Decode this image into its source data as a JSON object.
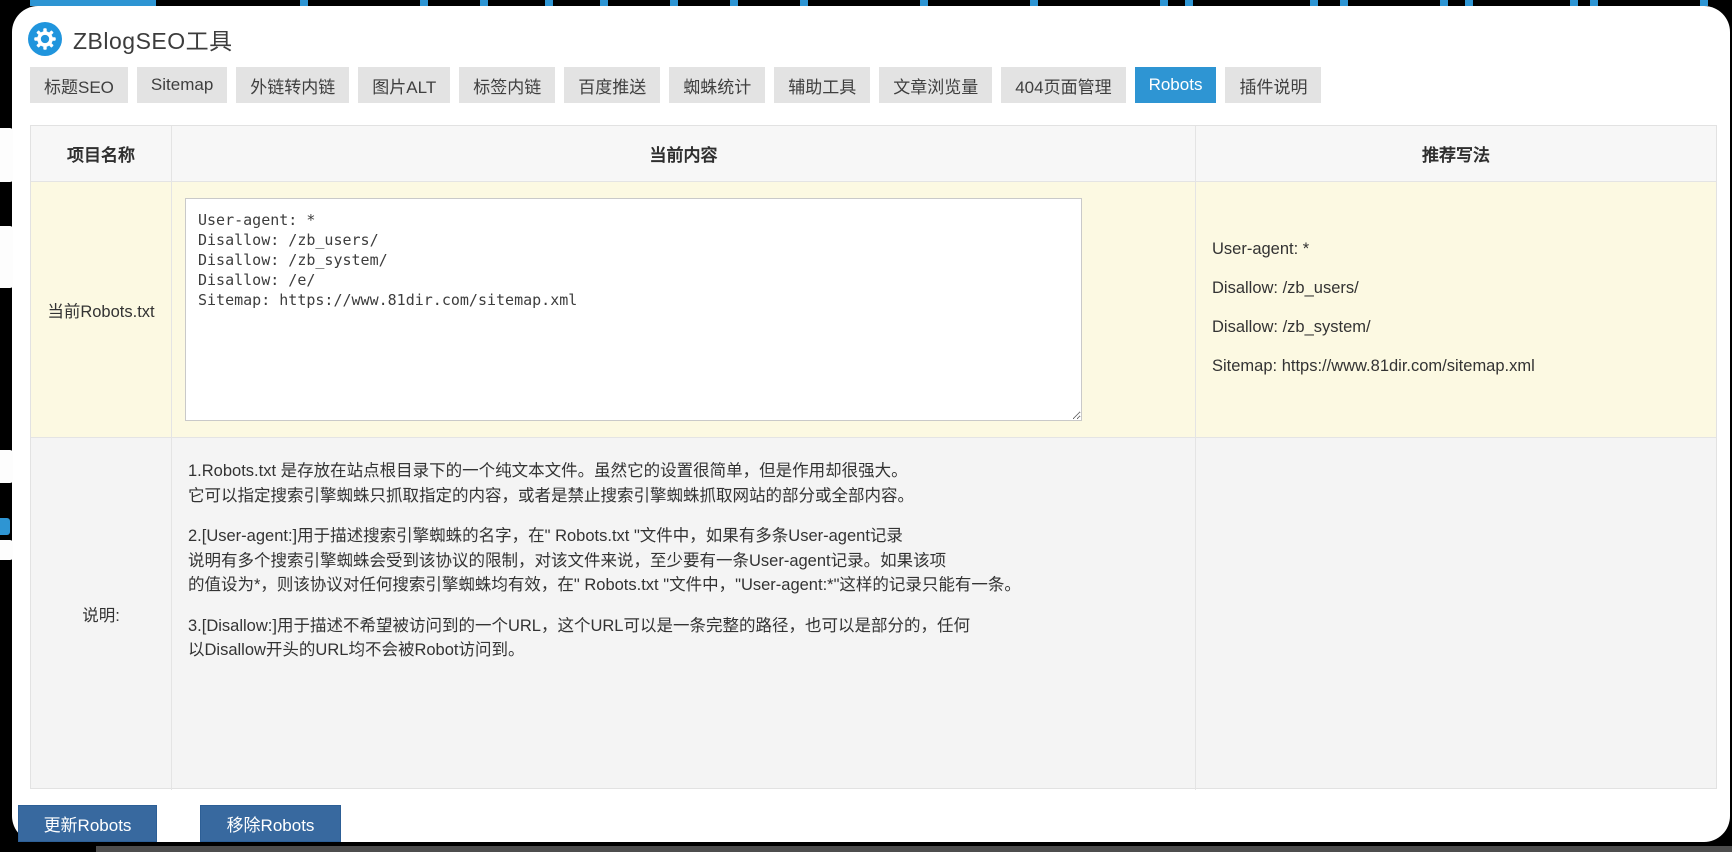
{
  "header": {
    "title": "ZBlogSEO工具"
  },
  "tabs": [
    {
      "label": "标题SEO",
      "active": false
    },
    {
      "label": "Sitemap",
      "active": false
    },
    {
      "label": "外链转内链",
      "active": false
    },
    {
      "label": "图片ALT",
      "active": false
    },
    {
      "label": "标签内链",
      "active": false
    },
    {
      "label": "百度推送",
      "active": false
    },
    {
      "label": "蜘蛛统计",
      "active": false
    },
    {
      "label": "辅助工具",
      "active": false
    },
    {
      "label": "文章浏览量",
      "active": false
    },
    {
      "label": "404页面管理",
      "active": false
    },
    {
      "label": "Robots",
      "active": true
    },
    {
      "label": "插件说明",
      "active": false
    }
  ],
  "table": {
    "headers": [
      "项目名称",
      "当前内容",
      "推荐写法"
    ],
    "rows": [
      {
        "name": "当前Robots.txt",
        "textarea_value": "User-agent: *\nDisallow: /zb_users/\nDisallow: /zb_system/\nDisallow: /e/\nSitemap: https://www.81dir.com/sitemap.xml",
        "recommended": [
          "User-agent: *",
          "Disallow: /zb_users/",
          "Disallow: /zb_system/",
          "Sitemap: https://www.81dir.com/sitemap.xml"
        ]
      },
      {
        "name": "说明:",
        "description_paragraphs": [
          "1.Robots.txt 是存放在站点根目录下的一个纯文本文件。虽然它的设置很简单，但是作用却很强大。\n它可以指定搜索引擎蜘蛛只抓取指定的内容，或者是禁止搜索引擎蜘蛛抓取网站的部分或全部内容。",
          "2.[User-agent:]用于描述搜索引擎蜘蛛的名字，在\" Robots.txt \"文件中，如果有多条User-agent记录\n说明有多个搜索引擎蜘蛛会受到该协议的限制，对该文件来说，至少要有一条User-agent记录。如果该项\n的值设为*，则该协议对任何搜索引擎蜘蛛均有效，在\" Robots.txt \"文件中，\"User-agent:*\"这样的记录只能有一条。",
          "3.[Disallow:]用于描述不希望被访问到的一个URL，这个URL可以是一条完整的路径，也可以是部分的，任何\n以Disallow开头的URL均不会被Robot访问到。"
        ]
      }
    ]
  },
  "actions": {
    "update_label": "更新Robots",
    "remove_label": "移除Robots"
  },
  "colors": {
    "accent_blue": "#2e95d3",
    "button_blue": "#38699f",
    "highlight_row": "#fcf9e2",
    "tab_gray": "#e3e3e3"
  }
}
